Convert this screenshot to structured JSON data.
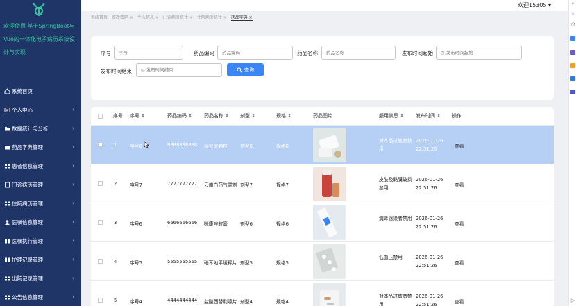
{
  "sidebar": {
    "welcome": "欢迎使用 基于SpringBoot与Vue的一体化电子病历系统设计与实现",
    "items": [
      {
        "label": "系统首页",
        "icon": "home-icon",
        "has_arrow": false
      },
      {
        "label": "个人中心",
        "icon": "profile-icon",
        "has_arrow": true
      },
      {
        "label": "数据统计与分析",
        "icon": "folder-icon",
        "has_arrow": true
      },
      {
        "label": "药品字典管理",
        "icon": "folder-icon",
        "has_arrow": true
      },
      {
        "label": "患者信息管理",
        "icon": "grid-icon",
        "has_arrow": true
      },
      {
        "label": "门诊病历管理",
        "icon": "document-icon",
        "has_arrow": true
      },
      {
        "label": "住院病历管理",
        "icon": "grid-icon",
        "has_arrow": true
      },
      {
        "label": "医嘱信息管理",
        "icon": "user-icon",
        "has_arrow": true
      },
      {
        "label": "医嘱执行管理",
        "icon": "grid-icon",
        "has_arrow": true
      },
      {
        "label": "护理记录管理",
        "icon": "grid-icon",
        "has_arrow": true
      },
      {
        "label": "出院记录管理",
        "icon": "grid-icon",
        "has_arrow": true
      },
      {
        "label": "公告信息管理",
        "icon": "grid-icon",
        "has_arrow": true
      }
    ]
  },
  "header": {
    "user": "欢迎15305 ▾"
  },
  "tabs": [
    {
      "label": "系统首页"
    },
    {
      "label": "修改密码 ×"
    },
    {
      "label": "个人信息 ×"
    },
    {
      "label": "门诊病历统计 ×"
    },
    {
      "label": "住院病历统计 ×"
    },
    {
      "label": "药品字典 ×",
      "active": true
    }
  ],
  "search": {
    "f1_label": "序号",
    "f1_placeholder": "序号",
    "f2_label": "药品编码",
    "f2_placeholder": "药品编码",
    "f3_label": "药品名称",
    "f3_placeholder": "药品名称",
    "f4_label": "发布时间起始",
    "f4_placeholder": "◷ 发布时间起始",
    "f5_label": "发布时间结束",
    "f5_placeholder": "◷ 发布时间结束",
    "button": "查询"
  },
  "table": {
    "headers": {
      "index": "序号",
      "no": "序号 ⇕",
      "code": "药品编码 ⇕",
      "name": "药品名称 ⇕",
      "form": "剂型 ⇕",
      "spec": "规格 ⇕",
      "image": "药品图片",
      "taboo": "服用禁忌 ⇕",
      "time": "发布时间 ⇕",
      "action": "操作"
    },
    "rows": [
      {
        "index": "1",
        "no": "序号8",
        "code": "8888888888",
        "name": "感冒灵颗粒",
        "form": "剂型8",
        "spec": "规格8",
        "taboo": "对本品过敏者禁用",
        "time": "2026-01-26 22:51:26",
        "action": "查看",
        "image": "white-box"
      },
      {
        "index": "2",
        "no": "序号7",
        "code": "7777777777",
        "name": "云南白药气雾剂",
        "form": "剂型7",
        "spec": "规格7",
        "taboo": "皮肤及黏膜破损禁用",
        "time": "2026-01-26 22:51:26",
        "action": "查看",
        "image": "red-bottle"
      },
      {
        "index": "3",
        "no": "序号6",
        "code": "6666666666",
        "name": "咪康唑软膏",
        "form": "剂型6",
        "spec": "规格6",
        "taboo": "病毒感染者禁用",
        "time": "2026-01-26 22:51:26",
        "action": "查看",
        "image": "tube"
      },
      {
        "index": "4",
        "no": "序号5",
        "code": "5555555555",
        "name": "硝苯地平缓释片",
        "form": "剂型5",
        "spec": "规格5",
        "taboo": "低血压禁用",
        "time": "2026-01-26 22:51:26",
        "action": "查看",
        "image": "blister"
      },
      {
        "index": "5",
        "no": "序号4",
        "code": "4444444444",
        "name": "盐酸西替利嗪片",
        "form": "剂型4",
        "spec": "规格4",
        "taboo": "对本品过敏者禁用",
        "time": "2026-01-26 22:51:26",
        "action": "查看",
        "image": "capsules"
      }
    ]
  },
  "colors": {
    "sidebar": "#1f3568",
    "accent": "#3a86f5",
    "welcome": "#35c49a",
    "selected": "#b5cff5"
  }
}
